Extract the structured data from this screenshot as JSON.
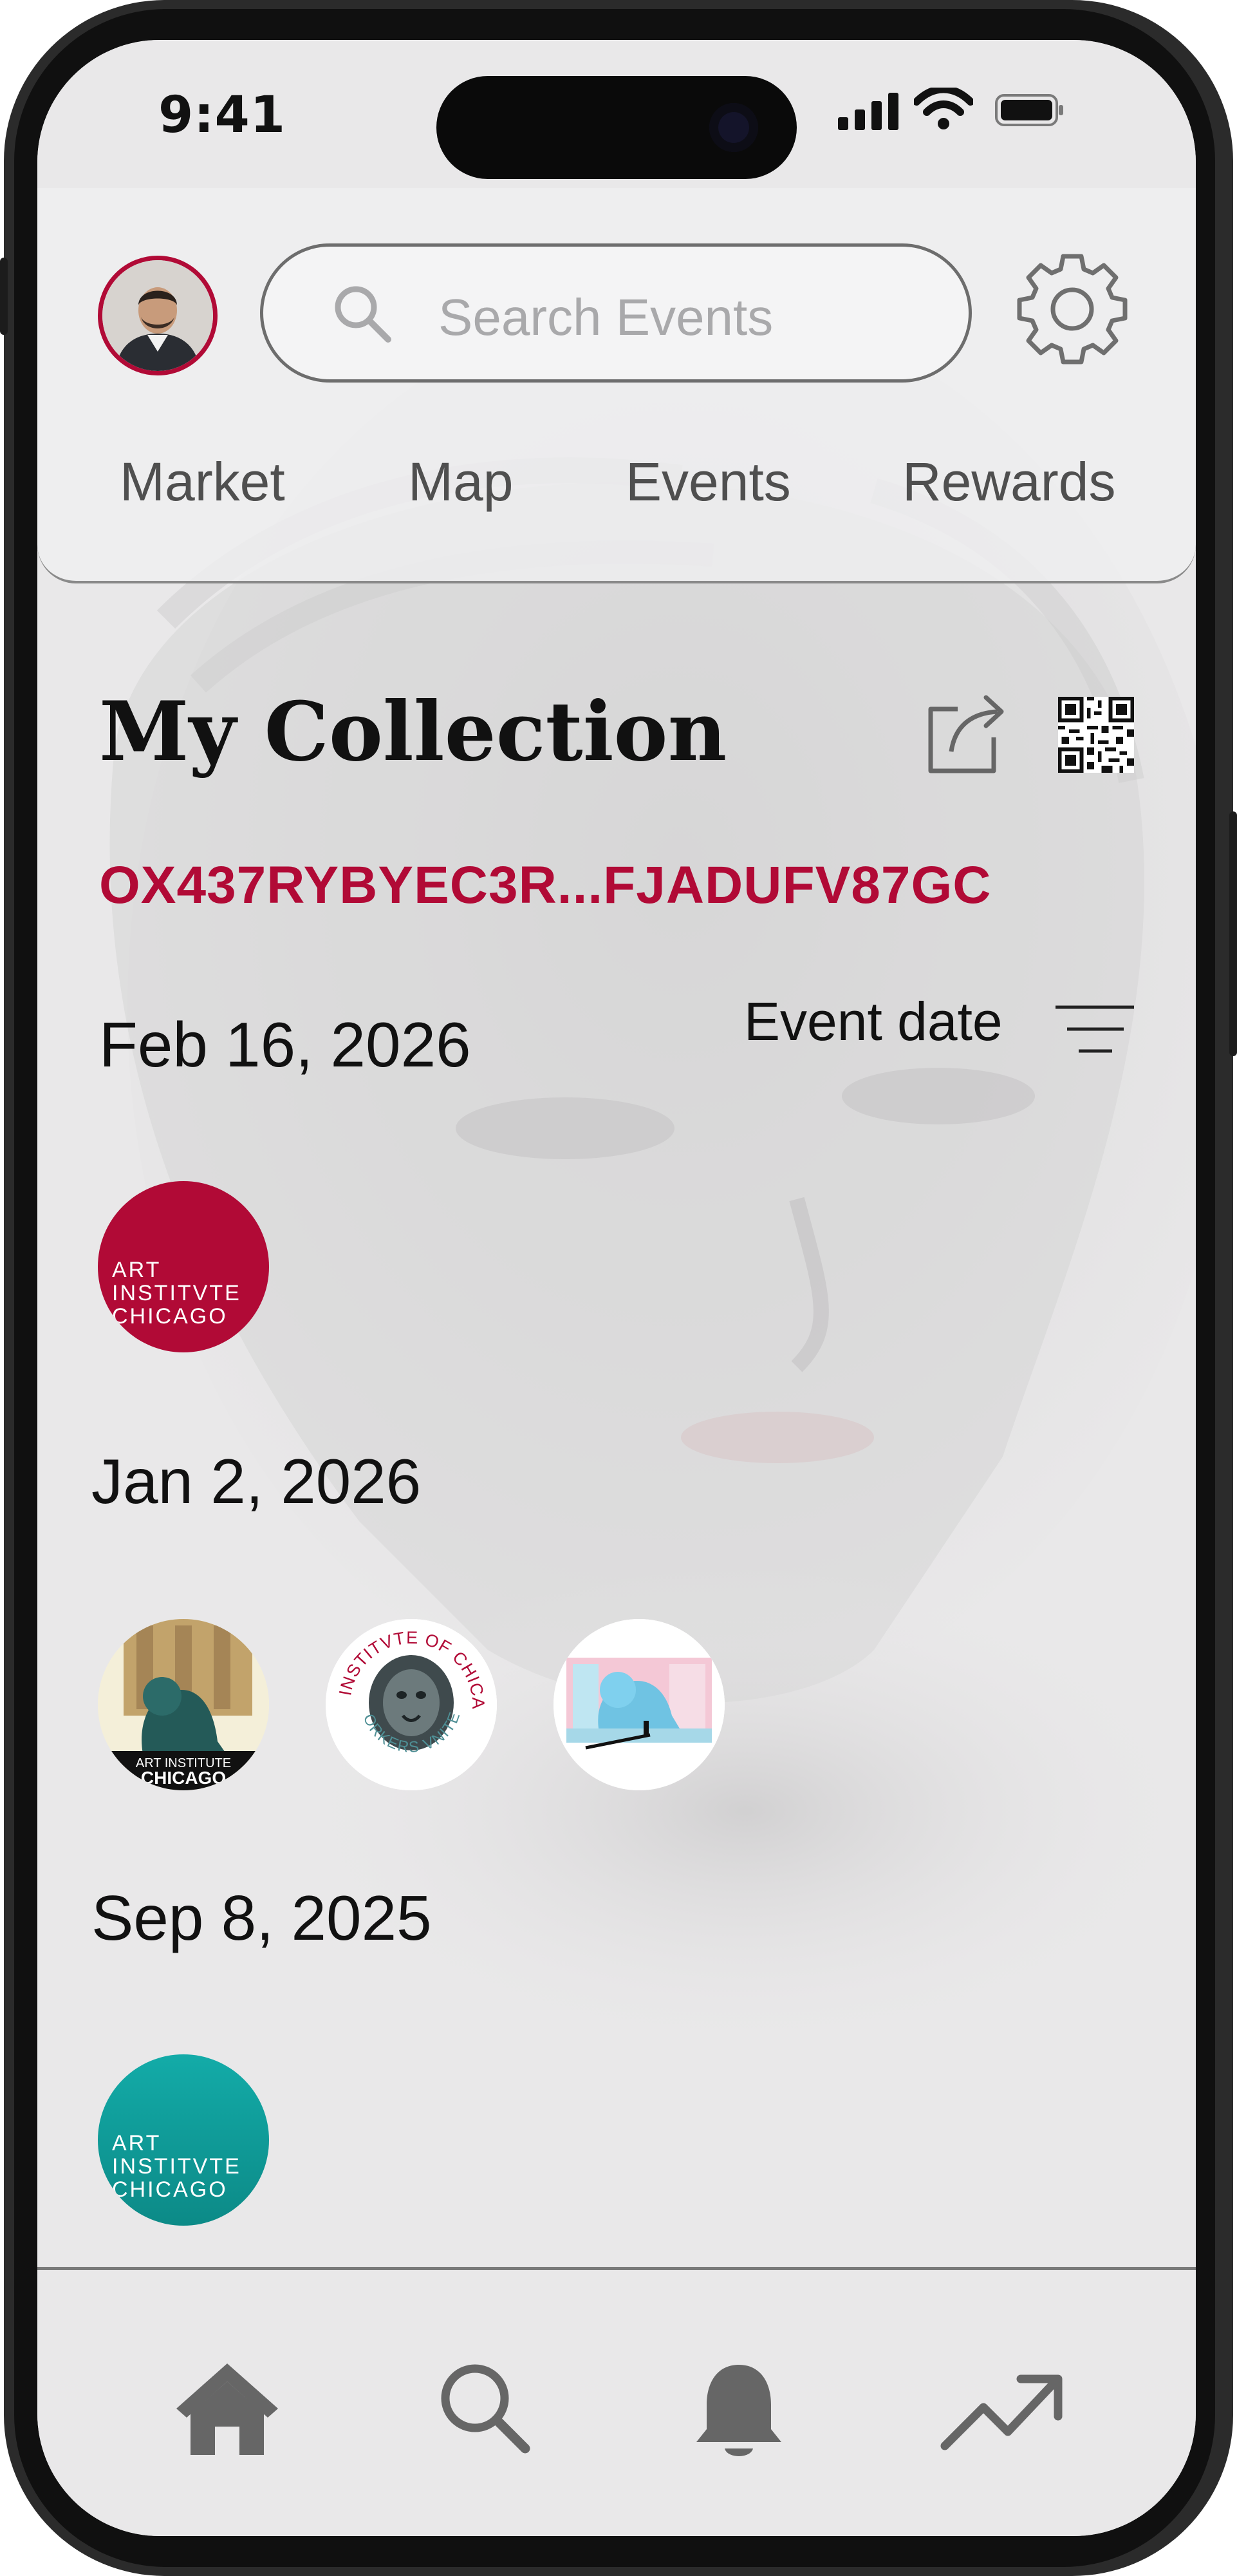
{
  "status_bar": {
    "time": "9:41"
  },
  "header": {
    "avatar": "user-avatar",
    "search": {
      "placeholder": "Search Events"
    },
    "tabs": [
      {
        "label": "Market"
      },
      {
        "label": "Map"
      },
      {
        "label": "Events"
      },
      {
        "label": "Rewards"
      }
    ]
  },
  "collection": {
    "title": "My Collection",
    "wallet_address": "OX437RYBYEC3R...FJADUFV87GC",
    "sort": {
      "label": "Event date"
    },
    "groups": [
      {
        "date": "Feb 16, 2026",
        "badges": [
          {
            "kind": "art-institute-red",
            "text": "ART\nINSTITVTE\nCHICAGO"
          }
        ]
      },
      {
        "date": "Jan 2, 2026",
        "badges": [
          {
            "kind": "lion-statue-photo",
            "text": "ART INSTITUTE\nCHICAGO"
          },
          {
            "kind": "workers-united-lion",
            "top_text": "ART INSTITVTE OF CHICAGO",
            "bottom_text": "WORKERS VNITED"
          },
          {
            "kind": "blue-lion-illustration"
          }
        ]
      },
      {
        "date": "Sep 8, 2025",
        "badges": [
          {
            "kind": "art-institute-teal",
            "text": "ART\nINSTITVTE\nCHICAGO"
          }
        ]
      }
    ]
  },
  "bottom_nav": [
    {
      "icon": "home-icon"
    },
    {
      "icon": "search-icon"
    },
    {
      "icon": "bell-icon"
    },
    {
      "icon": "trending-up-icon"
    }
  ],
  "colors": {
    "accent": "#b10a36",
    "teal": "#0f9f9d",
    "screen_bg": "#e9e8e9",
    "text": "#111111"
  }
}
